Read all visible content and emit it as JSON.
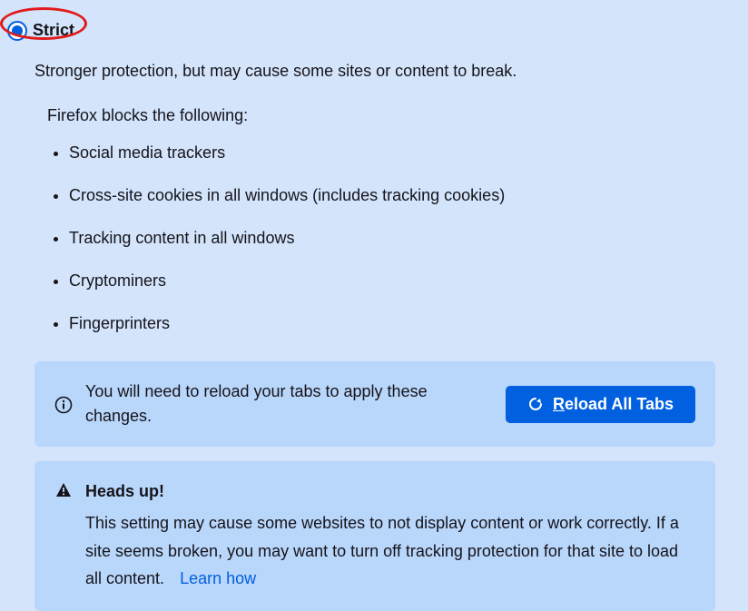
{
  "option": {
    "label": "Strict",
    "description": "Stronger protection, but may cause some sites or content to break.",
    "blocks_intro": "Firefox blocks the following:",
    "blocks": [
      "Social media trackers",
      "Cross-site cookies in all windows (includes tracking cookies)",
      "Tracking content in all windows",
      "Cryptominers",
      "Fingerprinters"
    ]
  },
  "reload": {
    "message": "You will need to reload your tabs to apply these changes.",
    "button_label": "Reload All Tabs"
  },
  "headsup": {
    "title": "Heads up!",
    "text": "This setting may cause some websites to not display content or work correctly. If a site seems broken, you may want to turn off tracking protection for that site to load all content.",
    "learn_label": "Learn how"
  }
}
